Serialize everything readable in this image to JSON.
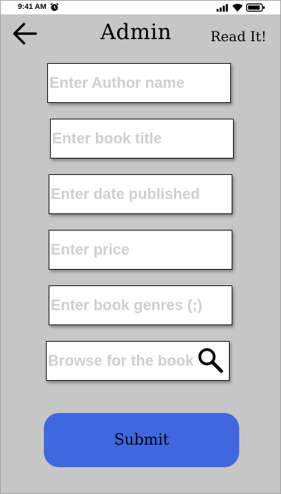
{
  "status_bar": {
    "time": "9:41 AM",
    "icons": [
      "alarm-icon",
      "signal-icon",
      "wifi-icon",
      "battery-icon"
    ]
  },
  "header": {
    "back_icon": "arrow-left-icon",
    "title": "Admin",
    "brand": "Read It!"
  },
  "form": {
    "author": {
      "placeholder": "Enter Author name",
      "value": ""
    },
    "title": {
      "placeholder": "Enter book title",
      "value": ""
    },
    "date": {
      "placeholder": "Enter date published",
      "value": ""
    },
    "price": {
      "placeholder": "Enter price",
      "value": ""
    },
    "genres": {
      "placeholder": "Enter book genres (;)",
      "value": ""
    },
    "browse": {
      "placeholder": "Browse for the book",
      "value": "",
      "icon": "search-icon"
    }
  },
  "submit_label": "Submit",
  "colors": {
    "background": "#c6c6c6",
    "submit_button": "#4167df",
    "placeholder": "#cfcfcf"
  }
}
